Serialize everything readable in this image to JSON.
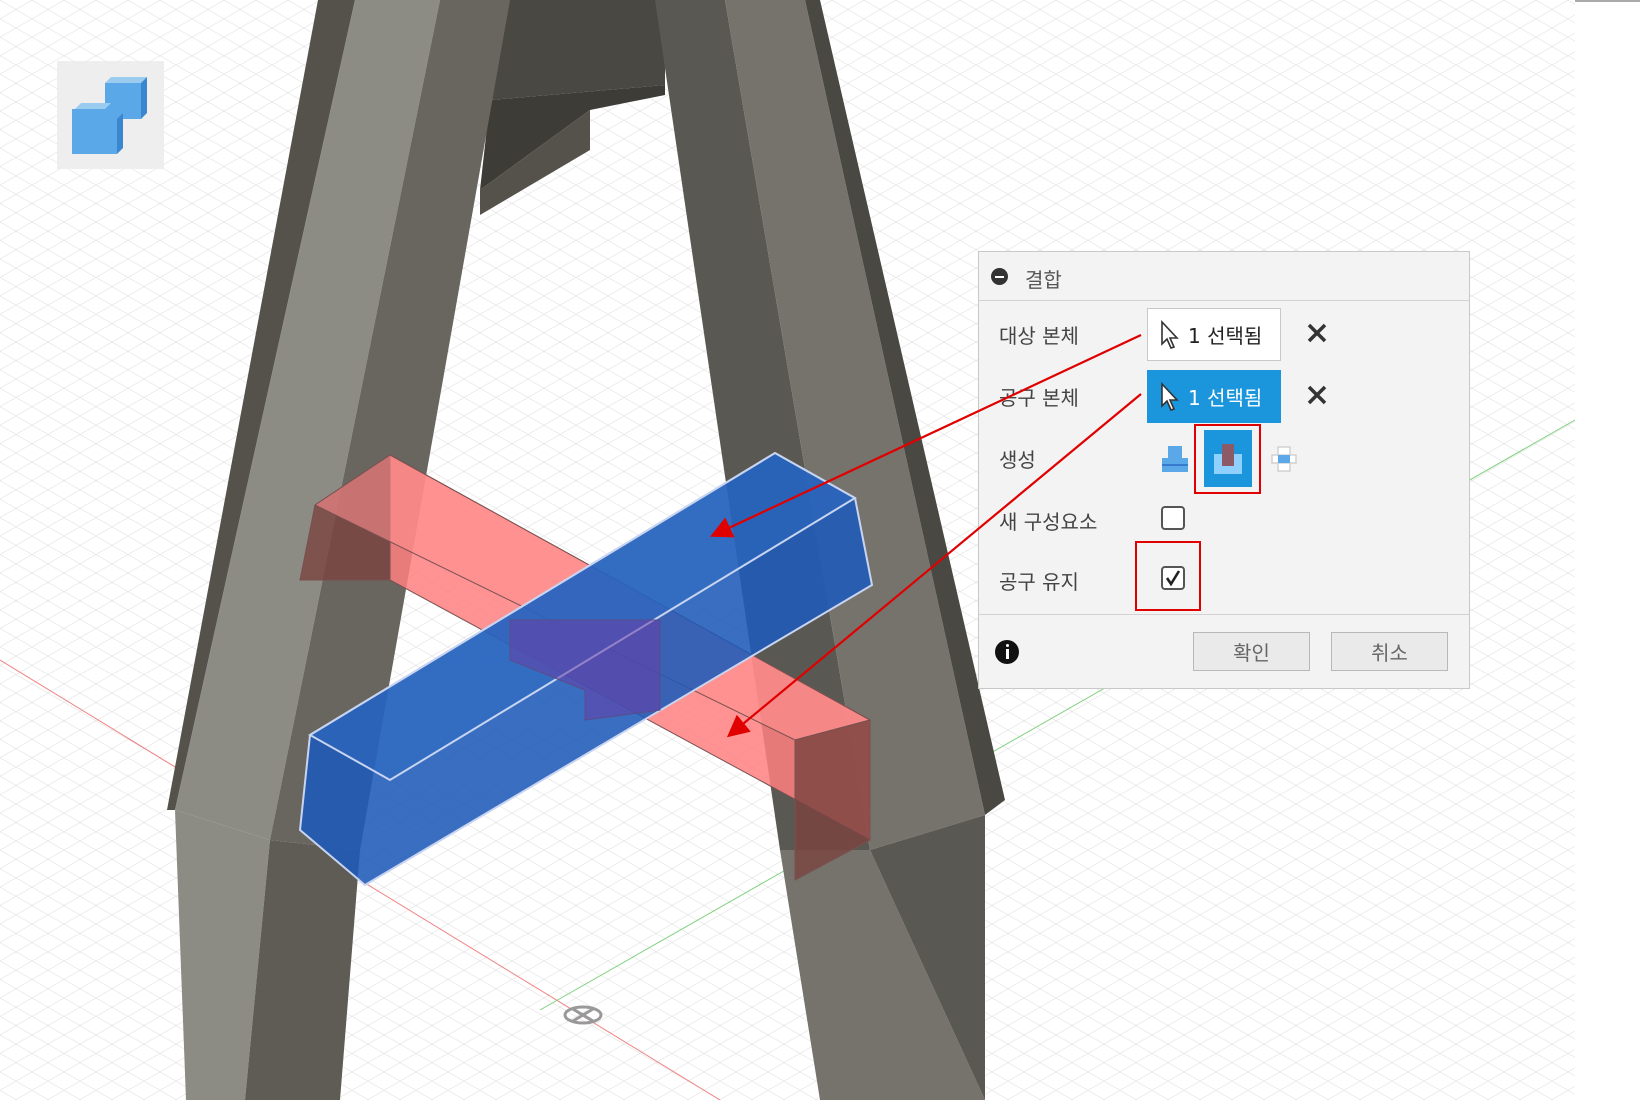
{
  "viewport": {
    "grid_color": "#d0d0d0",
    "frame_color": "#6e6a63",
    "target_body_color": "#ff8080",
    "tool_body_color": "#1e5ab8",
    "highlight_color": "#e00000"
  },
  "dialog": {
    "title": "결합",
    "rows": {
      "target_label": "대상 본체",
      "target_value": "1 선택됨",
      "tool_label": "공구 본체",
      "tool_value": "1 선택됨",
      "operation_label": "생성",
      "new_component_label": "새 구성요소",
      "keep_tools_label": "공구 유지"
    },
    "operation": {
      "options": [
        "join-icon",
        "cut-icon",
        "intersect-icon"
      ],
      "selected": "cut-icon"
    },
    "new_component_checked": false,
    "keep_tools_checked": true,
    "ok_label": "확인",
    "cancel_label": "취소",
    "accent_color": "#1b95dc"
  }
}
